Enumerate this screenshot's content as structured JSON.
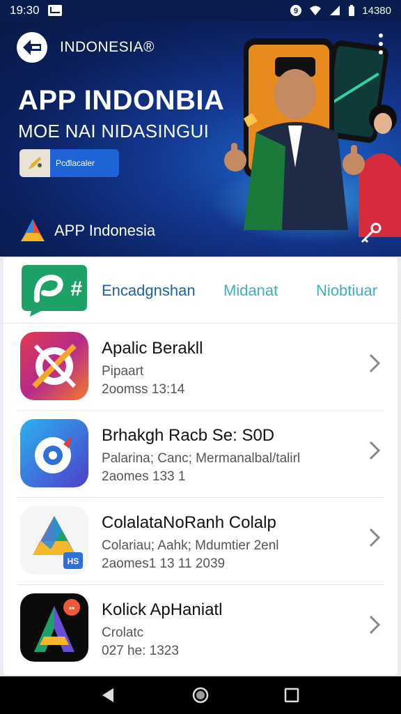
{
  "status_bar": {
    "time": "19:30",
    "battery_text": "14380",
    "icons": [
      "message-icon",
      "location-icon",
      "wifi-icon",
      "signal-icon",
      "battery-icon"
    ]
  },
  "hero": {
    "brand": "INDONESIA®",
    "title": "APP INDONBIA",
    "subtitle": "MOE NAI NIDASINGUI",
    "promo_label": "Pcđlacaler",
    "app_name": "APP Indonesia"
  },
  "tabs": [
    "Encadgnshan",
    "Midanat",
    "Niobtiuar"
  ],
  "apps": [
    {
      "title": "Apalic Berakll",
      "sub": "Pipaart",
      "date": "2oomss 13:14",
      "icon": "target-app-icon"
    },
    {
      "title": "Brhakgh Racb Se: S0D",
      "sub": "Palarina; Canc; Mermanalbal/talirl",
      "date": "2aomes 133 1",
      "icon": "compass-app-icon"
    },
    {
      "title": "ColalataNoRanh Colalp",
      "sub": "Colariau; Aahk; Mdumtier 2enl",
      "date": "2aomes1 13 11 2039",
      "icon": "drive-app-icon"
    },
    {
      "title": "Kolick ApHaniatl",
      "sub": "Crolatc",
      "date": "027 he: 1323",
      "icon": "letter-a-app-icon"
    }
  ],
  "colors": {
    "hero_bg": "#13378f",
    "tab_active": "#1d5fa8",
    "tab_inactive": "#3fb0b8",
    "promo_chip": "#1e64d6"
  }
}
